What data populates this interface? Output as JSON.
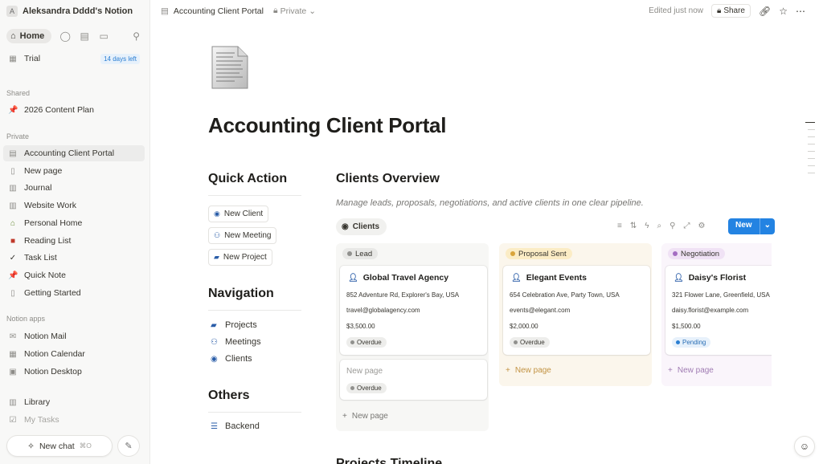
{
  "sidebar": {
    "workspace_initial": "A",
    "workspace_name": "Aleksandra Dddd's Notion",
    "home_label": "Home",
    "trial_label": "Trial",
    "trial_badge": "14 days left",
    "section_shared": "Shared",
    "shared_items": [
      {
        "label": "2026 Content Plan",
        "icon": "pushpin-icon"
      }
    ],
    "section_private": "Private",
    "private_items": [
      {
        "label": "Accounting Client Portal",
        "icon": "document-icon"
      },
      {
        "label": "New page",
        "icon": "page-icon"
      },
      {
        "label": "Journal",
        "icon": "notebook-icon"
      },
      {
        "label": "Website Work",
        "icon": "notebook-icon"
      },
      {
        "label": "Personal Home",
        "icon": "house-icon"
      },
      {
        "label": "Reading List",
        "icon": "book-icon"
      },
      {
        "label": "Task List",
        "icon": "checkmark-icon"
      },
      {
        "label": "Quick Note",
        "icon": "pushpin-icon"
      },
      {
        "label": "Getting Started",
        "icon": "page-icon"
      }
    ],
    "section_apps": "Notion apps",
    "app_items": [
      {
        "label": "Notion Mail",
        "icon": "mail-icon"
      },
      {
        "label": "Notion Calendar",
        "icon": "calendar-icon"
      },
      {
        "label": "Notion Desktop",
        "icon": "desktop-icon"
      }
    ],
    "library_label": "Library",
    "mytasks_label": "My Tasks",
    "new_chat_label": "New chat",
    "new_chat_shortcut": "⌘O"
  },
  "topbar": {
    "page_title": "Accounting Client Portal",
    "privacy": "Private",
    "edited": "Edited just now",
    "share_label": "Share"
  },
  "page": {
    "title": "Accounting Client Portal",
    "quick_action": {
      "heading": "Quick Action",
      "buttons": [
        "New Client",
        "New Meeting",
        "New Project"
      ]
    },
    "navigation": {
      "heading": "Navigation",
      "links": [
        "Projects",
        "Meetings",
        "Clients"
      ]
    },
    "others": {
      "heading": "Others",
      "links": [
        "Backend"
      ]
    },
    "next_section": "Projects Timeline"
  },
  "board": {
    "title": "Clients Overview",
    "description": "Manage leads, proposals, negotiations, and active clients in one clear pipeline.",
    "view_label": "Clients",
    "new_label": "New",
    "new_page_label": "New page",
    "columns": [
      {
        "label": "Lead",
        "color": "#91918e",
        "cards": [
          {
            "name": "Global Travel Agency",
            "address": "852 Adventure Rd, Explorer's Bay, USA",
            "email": "travel@globalagency.com",
            "amount": "$3,500.00",
            "status": "Overdue"
          },
          {
            "name": "New page",
            "status": "Overdue"
          }
        ]
      },
      {
        "label": "Proposal Sent",
        "color": "#d9a43b",
        "cards": [
          {
            "name": "Elegant Events",
            "address": "654 Celebration Ave, Party Town, USA",
            "email": "events@elegant.com",
            "amount": "$2,000.00",
            "status": "Overdue"
          }
        ]
      },
      {
        "label": "Negotiation",
        "color": "#a46cc2",
        "cards": [
          {
            "name": "Daisy's Florist",
            "address": "321 Flower Lane, Greenfield, USA",
            "email": "daisy.florist@example.com",
            "amount": "$1,500.00",
            "status": "Pending"
          }
        ]
      }
    ]
  },
  "colors": {
    "accent": "#2383e2",
    "overdue_bg": "#ededeb",
    "pending_bg": "#e7f1fb",
    "pending_dot": "#2a7ed2"
  }
}
